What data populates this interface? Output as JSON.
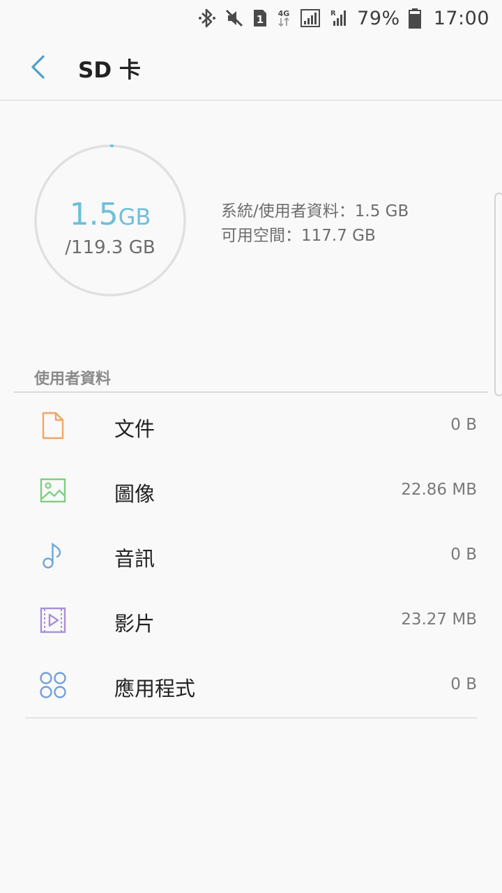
{
  "status_bar": {
    "battery": "79%",
    "time": "17:00",
    "network": "4G",
    "sim": "1",
    "roaming": "R"
  },
  "header": {
    "title": "SD 卡"
  },
  "storage": {
    "used_value": "1.5",
    "used_unit": "GB",
    "total": "/119.3 GB",
    "used_fraction": 0.0126,
    "system_user": "系統/使用者資料：1.5 GB",
    "available": "可用空間：117.7 GB",
    "ring_color": "#6dbfd9"
  },
  "section": {
    "title": "使用者資料"
  },
  "items": [
    {
      "label": "文件",
      "size": "0 B",
      "icon": "document-icon",
      "color": "#f0a564"
    },
    {
      "label": "圖像",
      "size": "22.86 MB",
      "icon": "image-icon",
      "color": "#7ccf7f"
    },
    {
      "label": "音訊",
      "size": "0 B",
      "icon": "music-note-icon",
      "color": "#6aa8d8"
    },
    {
      "label": "影片",
      "size": "23.27 MB",
      "icon": "video-icon",
      "color": "#a88fd8"
    },
    {
      "label": "應用程式",
      "size": "0 B",
      "icon": "apps-icon",
      "color": "#6fa0dc"
    }
  ]
}
